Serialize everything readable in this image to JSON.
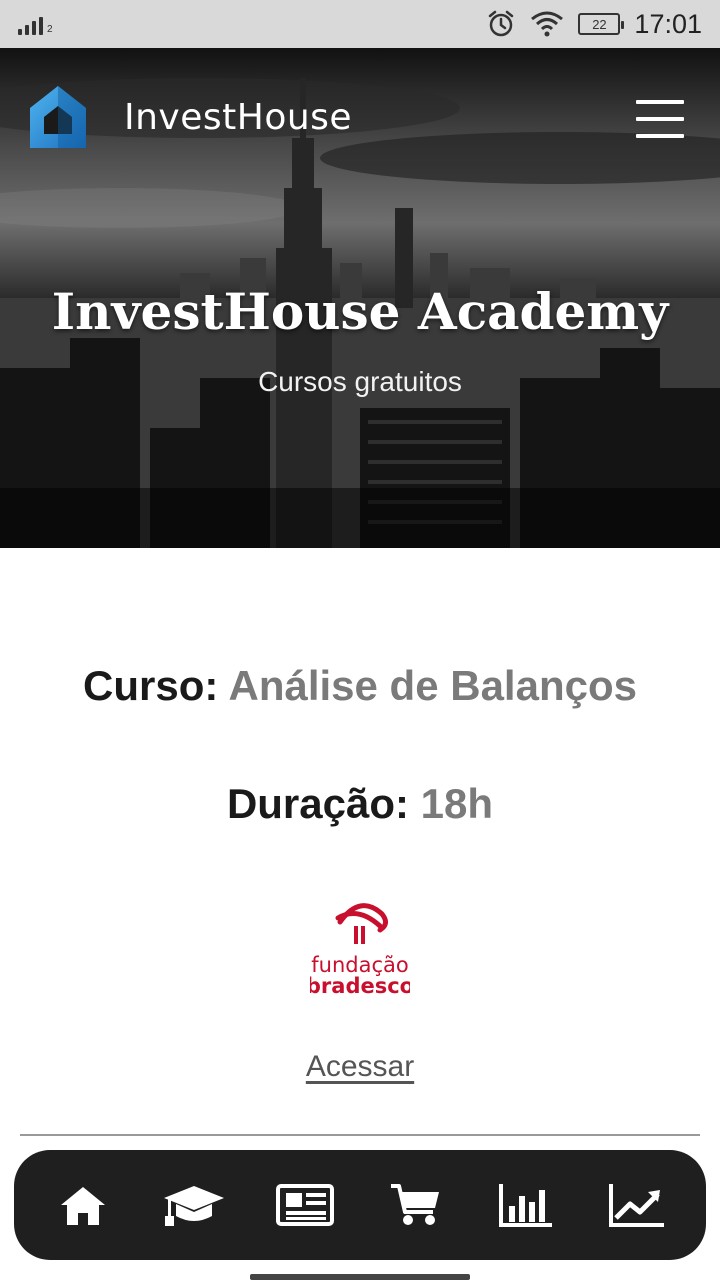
{
  "status_bar": {
    "signal_sub": "2",
    "battery": "22",
    "time": "17:01",
    "icons": [
      "signal-icon",
      "alarm-icon",
      "wifi-icon",
      "battery-icon"
    ]
  },
  "header": {
    "brand": "InvestHouse",
    "logo_icon": "house-logo-icon",
    "menu_icon": "hamburger-menu-icon"
  },
  "hero": {
    "title": "InvestHouse Academy",
    "subtitle": "Cursos gratuitos"
  },
  "course": {
    "name_label": "Curso:",
    "name_value": "Análise de Balanços",
    "duration_label": "Duração:",
    "duration_value": "18h",
    "partner_logo_line1": "fundação",
    "partner_logo_line2": "bradesco",
    "access_label": "Acessar"
  },
  "bottom_nav": {
    "items": [
      "home-icon",
      "graduation-cap-icon",
      "newspaper-icon",
      "cart-icon",
      "bar-chart-icon",
      "line-chart-icon"
    ]
  },
  "colors": {
    "accent_blue": "#2a8fd8",
    "partner_red": "#c8102e",
    "nav_bg": "#1f1f1f"
  }
}
